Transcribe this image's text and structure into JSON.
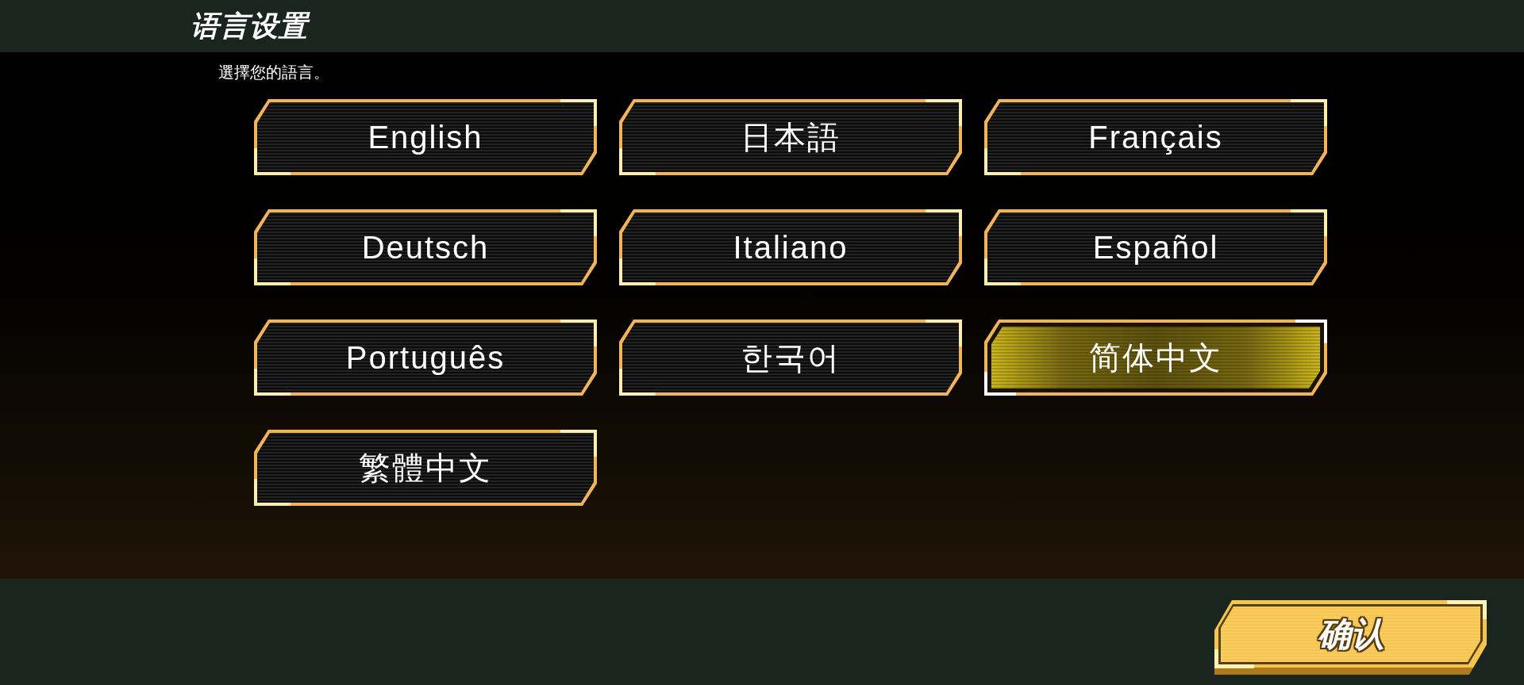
{
  "header": {
    "title": "语言设置"
  },
  "prompt": "選擇您的語言。",
  "languages": [
    {
      "label": "English",
      "selected": false
    },
    {
      "label": "日本語",
      "selected": false
    },
    {
      "label": "Français",
      "selected": false
    },
    {
      "label": "Deutsch",
      "selected": false
    },
    {
      "label": "Italiano",
      "selected": false
    },
    {
      "label": "Español",
      "selected": false
    },
    {
      "label": "Português",
      "selected": false
    },
    {
      "label": "한국어",
      "selected": false
    },
    {
      "label": "简体中文",
      "selected": true
    },
    {
      "label": "繁體中文",
      "selected": false
    }
  ],
  "confirm_button": {
    "label": "确认"
  }
}
